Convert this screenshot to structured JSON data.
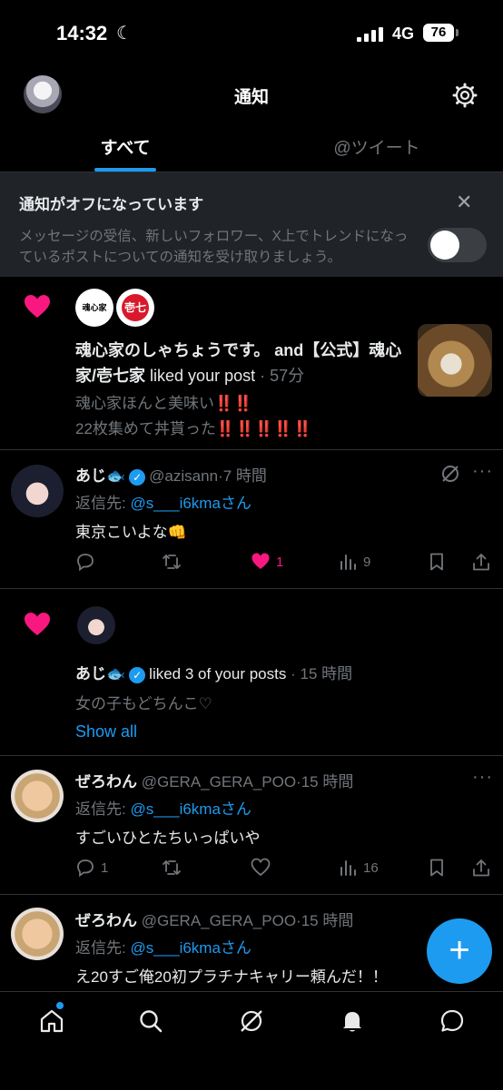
{
  "status": {
    "time": "14:32",
    "network": "4G",
    "battery": "76"
  },
  "header": {
    "title": "通知"
  },
  "tabs": [
    {
      "label": "すべて",
      "active": true
    },
    {
      "label": "@ツイート",
      "active": false
    }
  ],
  "banner": {
    "title": "通知がオフになっています",
    "body": "メッセージの受信、新しいフォロワー、X上でトレンドになっているポストについての通知を受け取りましょう。"
  },
  "notif1": {
    "logo1_text": "魂心家",
    "logo2_text": "壱七",
    "names": "魂心家のしゃちょうです。 and【公式】魂心家/壱七家",
    "action": "liked your post",
    "time": "· 57分",
    "line1": "魂心家ほんと美味い‼️‼️",
    "line2": "22枚集めて丼貰った‼️‼️‼️‼️‼️"
  },
  "tweet1": {
    "name": "あじ🐟",
    "handle": "@azisann",
    "time": "·7 時間",
    "reply_prefix": "返信先: ",
    "reply_to": "@s___i6kmaさん",
    "text": "東京こいよな👊",
    "likes": "1",
    "views": "9"
  },
  "notif2": {
    "name": "あじ🐟",
    "action": "liked 3 of your posts",
    "time": "· 15 時間",
    "text": "女の子もどちんこ♡",
    "show_all": "Show all"
  },
  "tweet2": {
    "name": "ぜろわん",
    "handle": "@GERA_GERA_POO",
    "time": "·15 時間",
    "reply_prefix": "返信先: ",
    "reply_to": "@s___i6kmaさん",
    "text": "すごいひとたちいっぱいや",
    "replies": "1",
    "views": "16"
  },
  "tweet3": {
    "name": "ぜろわん",
    "handle": "@GERA_GERA_POO",
    "time": "·15 時間",
    "reply_prefix": "返信先: ",
    "reply_to": "@s___i6kmaさん",
    "text": "え20すご俺20初プラチナキャリー頼んだ！！"
  },
  "fab": {
    "label": "+"
  }
}
